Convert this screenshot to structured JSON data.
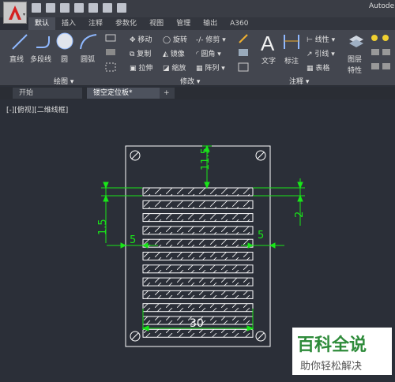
{
  "window": {
    "title": "Autode"
  },
  "ribbon_tabs": [
    "默认",
    "插入",
    "注释",
    "参数化",
    "视图",
    "管理",
    "输出",
    "A360"
  ],
  "draw_group": {
    "label": "绘图",
    "tools": {
      "line": "直线",
      "polyline": "多段线",
      "circle": "圆",
      "arc": "圆弧"
    }
  },
  "modify_group": {
    "label": "修改",
    "tools": {
      "move": "移动",
      "rotate": "旋转",
      "trim": "修剪",
      "copy": "复制",
      "mirror": "镜像",
      "fillet": "圆角",
      "stretch": "拉伸",
      "scale": "缩放",
      "array": "阵列"
    }
  },
  "annotation_group": {
    "label": "注释",
    "tools": {
      "text": "文字",
      "dimension": "标注",
      "linear": "线性",
      "leader": "引线",
      "table": "表格"
    }
  },
  "layers": {
    "label": "图层",
    "label2": "特性"
  },
  "doc_tabs": {
    "start": "开始",
    "active": "镂空定位板*",
    "add": "+"
  },
  "viewport_label": "[-][俯视][二维线框]",
  "drawing": {
    "dimensions": {
      "d_top": "11.5",
      "d_left": "1.5",
      "d_right": "2",
      "d_gap_left": "5",
      "d_gap_right": "5",
      "d_bottom": "30"
    }
  },
  "watermark": {
    "logo": "百科全说",
    "sub": "助你轻松解决"
  },
  "colors": {
    "dim": "#19e619",
    "drawing": "#ffffff",
    "bg": "#2b2f38"
  }
}
